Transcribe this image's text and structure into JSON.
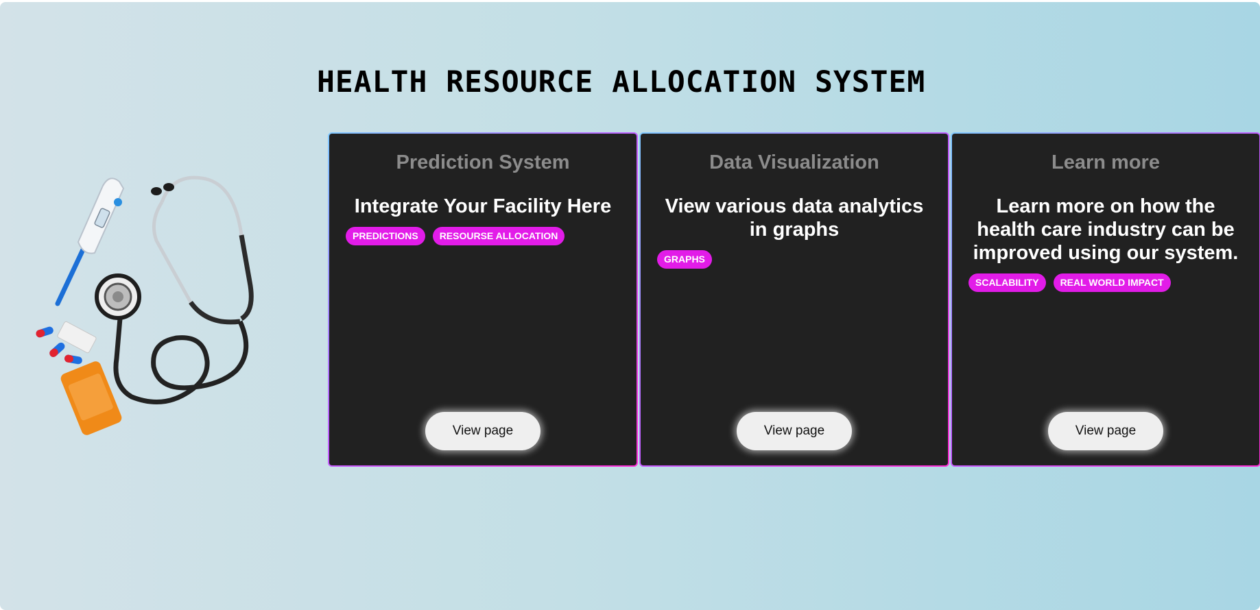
{
  "header": {
    "title": "HEALTH RESOURCE ALLOCATION SYSTEM"
  },
  "illustration": {
    "icons": [
      "thermometer-icon",
      "stethoscope-icon",
      "pills-icon",
      "pill-bottle-icon"
    ]
  },
  "colors": {
    "card_bg": "#212121",
    "tag_bg": "#e21ce8",
    "button_bg": "#efefef",
    "card_title": "#8c8c8c"
  },
  "cards": [
    {
      "title": "Prediction System",
      "headline": "Integrate Your Facility Here",
      "tags": [
        "PREDICTIONS",
        "RESOURSE ALLOCATION"
      ],
      "button": "View page"
    },
    {
      "title": "Data Visualization",
      "headline": "View various data analytics in graphs",
      "tags": [
        "GRAPHS"
      ],
      "button": "View page"
    },
    {
      "title": "Learn more",
      "headline": "Learn more on how the health care industry can be improved using our system.",
      "tags": [
        "SCALABILITY",
        "REAL WORLD IMPACT"
      ],
      "button": "View page"
    }
  ]
}
